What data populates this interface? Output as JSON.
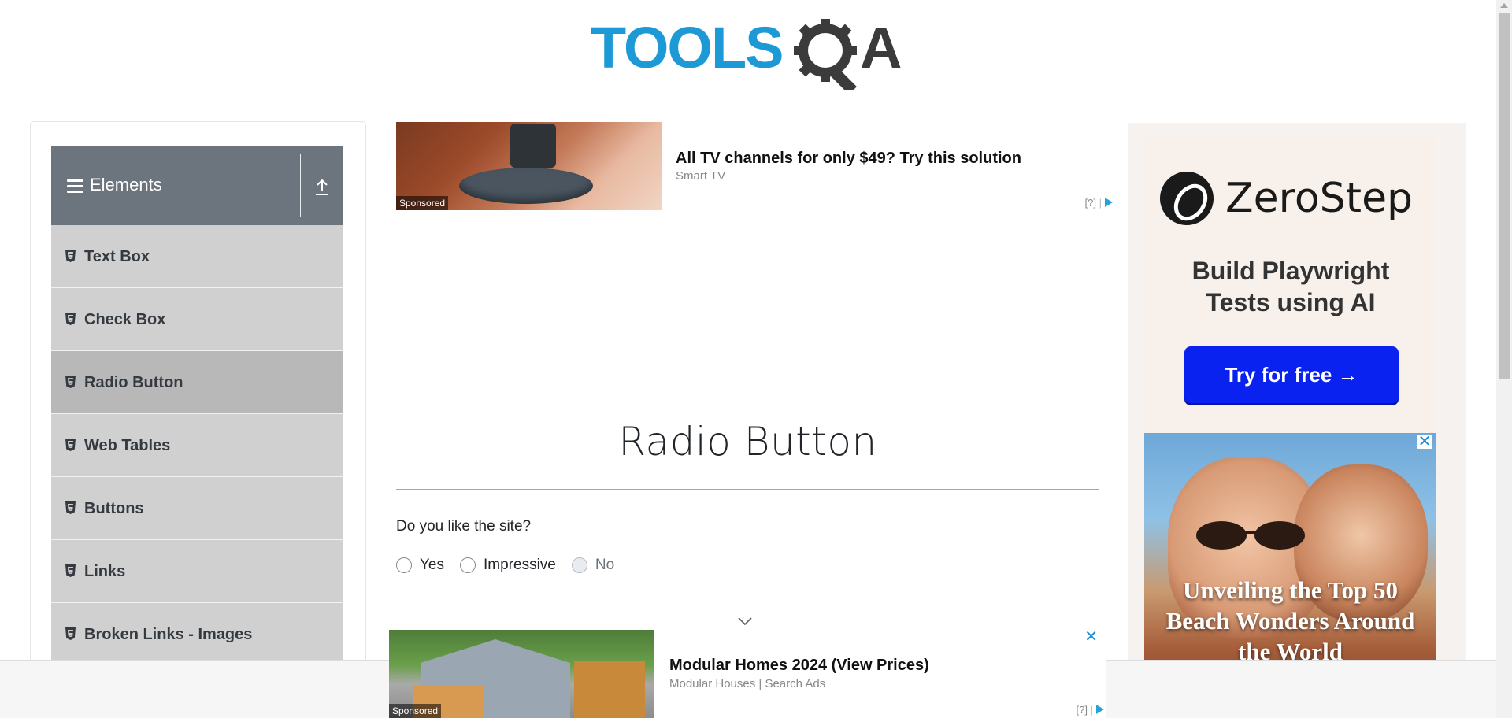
{
  "header": {
    "logo_alt": "TOOLSQA"
  },
  "sidebar": {
    "group_title": "Elements",
    "items": [
      {
        "label": "Text Box",
        "active": false
      },
      {
        "label": "Check Box",
        "active": false
      },
      {
        "label": "Radio Button",
        "active": true
      },
      {
        "label": "Web Tables",
        "active": false
      },
      {
        "label": "Buttons",
        "active": false
      },
      {
        "label": "Links",
        "active": false
      },
      {
        "label": "Broken Links - Images",
        "active": false
      }
    ]
  },
  "ad_top": {
    "title": "All TV channels for only $49? Try this solution",
    "source": "Smart TV",
    "sponsored": "Sponsored",
    "info": "[?]"
  },
  "main": {
    "page_title": "Radio Button",
    "question": "Do you like the site?",
    "options": [
      {
        "label": "Yes",
        "disabled": false
      },
      {
        "label": "Impressive",
        "disabled": false
      },
      {
        "label": "No",
        "disabled": true
      }
    ]
  },
  "right_ad": {
    "brand": "ZeroStep",
    "tagline": "Build Playwright Tests using AI",
    "cta": "Try for free →",
    "photo_headline": "Unveiling the Top 50 Beach Wonders Around the World",
    "close": "✕"
  },
  "bottom_ad": {
    "title": "Modular Homes 2024 (View Prices)",
    "source": "Modular Houses | Search Ads",
    "sponsored": "Sponsored",
    "info": "[?]",
    "close": "✕"
  },
  "colors": {
    "accent_blue": "#1d9ad6",
    "logo_dark": "#3b3b3b",
    "header_gray": "#6c757d",
    "menu_gray": "#d0d0d0",
    "cta_blue": "#0a22f0"
  }
}
